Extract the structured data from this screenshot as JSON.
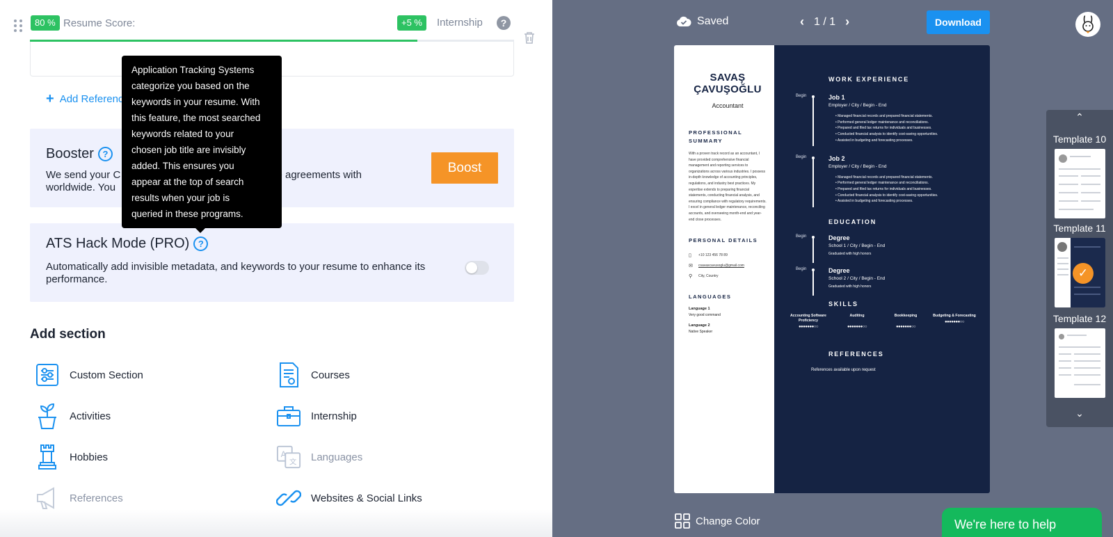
{
  "header": {
    "score_badge": "80 %",
    "score_label": "Resume Score:",
    "score_value": 0.8,
    "gain_badge": "+5 %",
    "gain_section": "Internship",
    "help": "?"
  },
  "references": {
    "add_label": "Add Reference"
  },
  "tooltip": {
    "lines": [
      "Application Tracking Systems",
      "categorize you based on the",
      "keywords in your resume. With",
      "this feature, the most searched",
      "keywords related to your",
      "chosen job title are invisibly",
      "added. This ensures you",
      "appear at the top of search",
      "results when your job is",
      "queried in these programs."
    ]
  },
  "booster": {
    "title": "Booster",
    "desc_line1_start": "We send your C",
    "desc_line1_end": "have agreements with",
    "desc_line2": "worldwide. You",
    "button": "Boost"
  },
  "ats": {
    "title": "ATS Hack Mode (PRO)",
    "desc": "Automatically add invisible metadata, and keywords to your resume to enhance its performance.",
    "enabled": false
  },
  "add_section": {
    "title": "Add section",
    "items": [
      {
        "label": "Custom Section",
        "icon": "sliders-icon",
        "muted": false
      },
      {
        "label": "Courses",
        "icon": "certificate-icon",
        "muted": false
      },
      {
        "label": "Activities",
        "icon": "plant-icon",
        "muted": false
      },
      {
        "label": "Internship",
        "icon": "briefcase-icon",
        "muted": false
      },
      {
        "label": "Hobbies",
        "icon": "chess-rook-icon",
        "muted": false
      },
      {
        "label": "Languages",
        "icon": "translate-icon",
        "muted": true
      },
      {
        "label": "References",
        "icon": "megaphone-icon",
        "muted": true
      },
      {
        "label": "Websites & Social Links",
        "icon": "link-icon",
        "muted": false
      }
    ]
  },
  "topbar": {
    "saved": "Saved",
    "page": "1 / 1",
    "download": "Download"
  },
  "resume": {
    "name_line1": "SAVAŞ",
    "name_line2": "ÇAVUŞOĞLU",
    "title": "Accountant",
    "summary_heading_1": "PROFESSIONAL",
    "summary_heading_2": "SUMMARY",
    "summary": "With a proven track record as an accountant, I have provided comprehensive financial management and reporting services to organizations across various industries. I possess in-depth knowledge of accounting principles, regulations, and industry best practices. My expertise extends to preparing financial statements, conducting financial analysis, and ensuring compliance with regulatory requirements. I excel in general ledger maintenance, reconciling accounts, and overseeing month-end and year-end close processes.",
    "personal_heading": "PERSONAL DETAILS",
    "phone": "+10 123 456 78 89",
    "email": "csavascavusoglu@gmail.com",
    "location": "City, Country",
    "languages_heading": "LANGUAGES",
    "lang1": "Language 1",
    "lang1_level": "Very good command",
    "lang2": "Language 2",
    "lang2_level": "Native Speaker",
    "work_heading": "WORK EXPERIENCE",
    "begin": "Begin",
    "job1": "Job 1",
    "job2": "Job 2",
    "job_sub": "Employer / City / Begin - End",
    "bullets": [
      "Managed financial records and prepared financial statements.",
      "Performed general ledger maintenance and reconciliations.",
      "Prepared and filed tax returns for individuals and businesses.",
      "Conducted financial analysis to identify cost-saving opportunities.",
      "Assisted in budgeting and forecasting processes."
    ],
    "education_heading": "EDUCATION",
    "degree": "Degree",
    "school1": "School 1 / City / Begin - End",
    "school2": "School 2 / City / Begin - End",
    "honors": "Graduated with high honors",
    "skills_heading": "SKILLS",
    "skills": [
      {
        "name": "Accounting Software Proficiency",
        "dots": "●●●●●●●○○"
      },
      {
        "name": "Auditing",
        "dots": "●●●●●●●○○"
      },
      {
        "name": "Bookkeeping",
        "dots": "●●●●●●●○○"
      },
      {
        "name": "Budgeting & Forecasting",
        "dots": "●●●●●●●○○"
      }
    ],
    "references_heading": "REFERENCES",
    "references_text": "References available upon request"
  },
  "templates": [
    {
      "label": "Template 10",
      "selected": false
    },
    {
      "label": "Template 11",
      "selected": true
    },
    {
      "label": "Template 12",
      "selected": false
    }
  ],
  "footer": {
    "change_color": "Change Color",
    "help_chat": "We're here to help"
  },
  "colors": {
    "accent": "#1a91f0",
    "success": "#2dc262",
    "boost": "#f59427",
    "resume_navy": "#152343"
  }
}
